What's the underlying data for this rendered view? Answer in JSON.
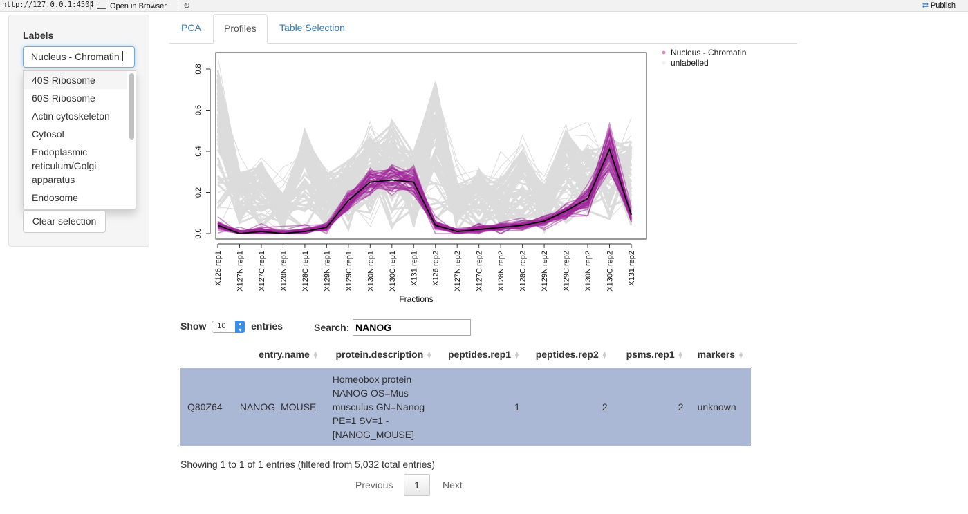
{
  "browser": {
    "url": "http://127.0.0.1:4504",
    "open_label": "Open in Browser",
    "publish_label": "Publish"
  },
  "sidebar": {
    "label": "Labels",
    "selected": "Nucleus - Chromatin",
    "options": [
      "40S Ribosome",
      "60S Ribosome",
      "Actin cytoskeleton",
      "Cytosol",
      "Endoplasmic reticulum/Golgi apparatus",
      "Endosome"
    ],
    "clear_label": "Clear selection"
  },
  "tabs": [
    {
      "label": "PCA",
      "active": false
    },
    {
      "label": "Profiles",
      "active": true
    },
    {
      "label": "Table Selection",
      "active": false
    }
  ],
  "chart_data": {
    "type": "line",
    "xlabel": "Fractions",
    "ylabel": "",
    "ylim": [
      0,
      0.85
    ],
    "yticks": [
      0.0,
      0.2,
      0.4,
      0.6,
      0.8
    ],
    "categories": [
      "X126.rep1",
      "X127N.rep1",
      "X127C.rep1",
      "X128N.rep1",
      "X128C.rep1",
      "X129N.rep1",
      "X129C.rep1",
      "X130N.rep1",
      "X130C.rep1",
      "X131.rep1",
      "X126.rep2",
      "X127N.rep2",
      "X127C.rep2",
      "X128N.rep2",
      "X128C.rep2",
      "X129N.rep2",
      "X129C.rep2",
      "X130N.rep2",
      "X130C.rep2",
      "X131.rep2"
    ],
    "legend_position": "top-right",
    "legend": [
      "Nucleus - Chromatin",
      "unlabelled"
    ],
    "colors": {
      "labelled": "#a0249a",
      "unlabelled": "#dcdcdc",
      "mean": "#000000"
    },
    "series": [
      {
        "name": "Nucleus - Chromatin",
        "values": [
          0.04,
          0.0,
          0.01,
          0.0,
          0.01,
          0.03,
          0.16,
          0.25,
          0.26,
          0.25,
          0.04,
          0.01,
          0.02,
          0.03,
          0.04,
          0.06,
          0.11,
          0.17,
          0.41,
          0.09
        ]
      },
      {
        "name": "unlabelled",
        "values": [
          0.8,
          0.3,
          0.34,
          0.19,
          0.5,
          0.3,
          0.35,
          0.46,
          0.54,
          0.4,
          0.74,
          0.24,
          0.3,
          0.27,
          0.4,
          0.24,
          0.5,
          0.41,
          0.48,
          0.45
        ]
      }
    ]
  },
  "table": {
    "show_label": "Show",
    "length_value": "10",
    "entries_label": "entries",
    "search_label": "Search:",
    "search_value": "NANOG",
    "columns": [
      "",
      "entry.name",
      "protein.description",
      "peptides.rep1",
      "peptides.rep2",
      "psms.rep1",
      "markers"
    ],
    "row": {
      "id": "Q80Z64",
      "entry_name": "NANOG_MOUSE",
      "description": "Homeobox protein NANOG OS=Mus musculus GN=Nanog PE=1 SV=1 - [NANOG_MOUSE]",
      "peptides_rep1": "1",
      "peptides_rep2": "2",
      "psms_rep1": "2",
      "markers": "unknown"
    },
    "info": "Showing 1 to 1 of 1 entries (filtered from 5,032 total entries)",
    "prev_label": "Previous",
    "page": "1",
    "next_label": "Next"
  }
}
